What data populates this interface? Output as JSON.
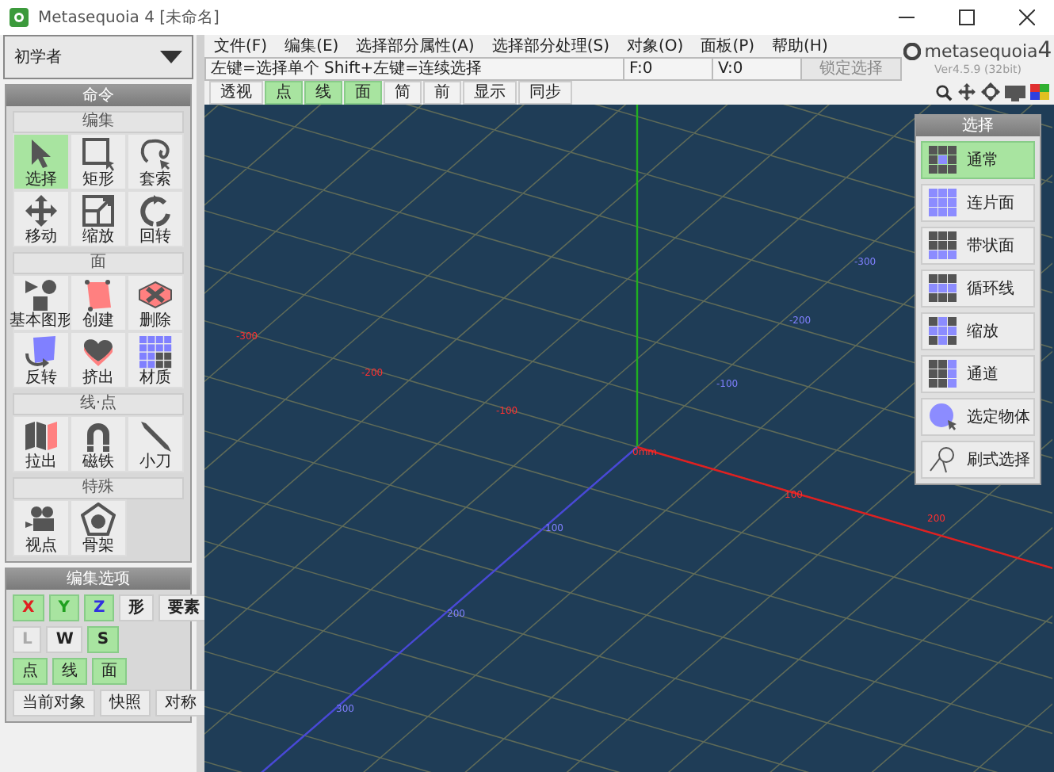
{
  "window": {
    "title": "Metasequoia 4 [未命名]"
  },
  "mode_dropdown": {
    "value": "初学者"
  },
  "menu": [
    "文件(F)",
    "编集(E)",
    "选择部分属性(A)",
    "选择部分处理(S)",
    "对象(O)",
    "面板(P)",
    "帮助(H)"
  ],
  "status_bar": {
    "hint": "左键=选择单个  Shift+左键=连续选择",
    "faces": "F:0",
    "vertices": "V:0",
    "lock_button": "锁定选择"
  },
  "logo": {
    "name": "metasequoia",
    "number": "4",
    "version": "Ver4.5.9 (32bit)"
  },
  "toolbar": [
    {
      "label": "透视",
      "selected": false
    },
    {
      "label": "点",
      "selected": true
    },
    {
      "label": "线",
      "selected": true
    },
    {
      "label": "面",
      "selected": true
    },
    {
      "label": "简",
      "selected": false
    },
    {
      "label": "前",
      "selected": false
    },
    {
      "label": "显示",
      "selected": false
    },
    {
      "label": "同步",
      "selected": false
    }
  ],
  "command_panel": {
    "title": "命令",
    "groups": [
      {
        "title": "编集",
        "tools": [
          {
            "label": "选择",
            "selected": true
          },
          {
            "label": "矩形",
            "selected": false
          },
          {
            "label": "套索",
            "selected": false
          },
          {
            "label": "移动",
            "selected": false
          },
          {
            "label": "缩放",
            "selected": false
          },
          {
            "label": "回转",
            "selected": false
          }
        ]
      },
      {
        "title": "面",
        "tools": [
          {
            "label": "基本图形",
            "selected": false
          },
          {
            "label": "创建",
            "selected": false
          },
          {
            "label": "删除",
            "selected": false
          },
          {
            "label": "反转",
            "selected": false
          },
          {
            "label": "挤出",
            "selected": false
          },
          {
            "label": "材质",
            "selected": false
          }
        ]
      },
      {
        "title": "线·点",
        "tools": [
          {
            "label": "拉出",
            "selected": false
          },
          {
            "label": "磁铁",
            "selected": false
          },
          {
            "label": "小刀",
            "selected": false
          }
        ]
      },
      {
        "title": "特殊",
        "tools": [
          {
            "label": "视点",
            "selected": false
          },
          {
            "label": "骨架",
            "selected": false
          }
        ]
      }
    ]
  },
  "edit_options": {
    "title": "编集选项",
    "axis_buttons": [
      {
        "label": "X",
        "selected": true,
        "kind": "x"
      },
      {
        "label": "Y",
        "selected": true,
        "kind": "y"
      },
      {
        "label": "Z",
        "selected": true,
        "kind": "z"
      },
      {
        "label": "形",
        "selected": false,
        "kind": "plain"
      },
      {
        "label": "要素",
        "selected": false,
        "kind": "plain"
      }
    ],
    "coordinate_buttons": [
      {
        "label": "L",
        "selected": false,
        "disabled": true
      },
      {
        "label": "W",
        "selected": false,
        "disabled": false
      },
      {
        "label": "S",
        "selected": true,
        "disabled": false
      }
    ],
    "element_buttons": [
      {
        "label": "点",
        "selected": true
      },
      {
        "label": "线",
        "selected": true
      },
      {
        "label": "面",
        "selected": true
      }
    ],
    "action_buttons": [
      "当前对象",
      "快照",
      "对称"
    ]
  },
  "select_panel": {
    "title": "选择",
    "items": [
      {
        "label": "通常",
        "selected": true
      },
      {
        "label": "连片面",
        "selected": false
      },
      {
        "label": "带状面",
        "selected": false
      },
      {
        "label": "循环线",
        "selected": false
      },
      {
        "label": "缩放",
        "selected": false
      },
      {
        "label": "通道",
        "selected": false
      },
      {
        "label": "选定物体",
        "selected": false
      },
      {
        "label": "刷式选择",
        "selected": false
      }
    ]
  },
  "viewport": {
    "axis_labels": [
      {
        "text": "-300",
        "kind": "x"
      },
      {
        "text": "-200",
        "kind": "x"
      },
      {
        "text": "-100",
        "kind": "x"
      },
      {
        "text": "0mm",
        "kind": "x"
      },
      {
        "text": "100",
        "kind": "x"
      },
      {
        "text": "200",
        "kind": "x"
      },
      {
        "text": "-300",
        "kind": "z"
      },
      {
        "text": "-200",
        "kind": "z"
      },
      {
        "text": "-100",
        "kind": "z"
      },
      {
        "text": "100",
        "kind": "z"
      },
      {
        "text": "200",
        "kind": "z"
      },
      {
        "text": "300",
        "kind": "z"
      }
    ]
  }
}
